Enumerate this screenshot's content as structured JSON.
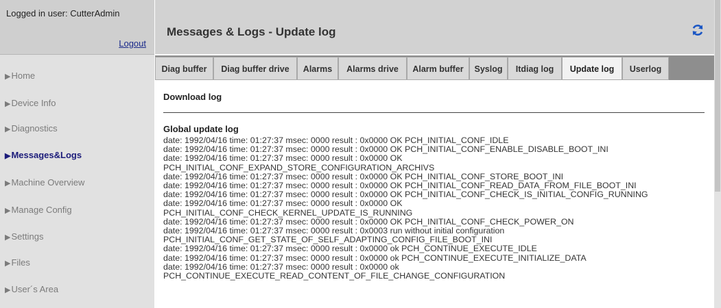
{
  "login": {
    "text": "Logged in user: CutterAdmin",
    "logout": "Logout"
  },
  "nav": {
    "items": [
      {
        "label": "Home",
        "active": false
      },
      {
        "label": "Device Info",
        "active": false
      },
      {
        "label": "Diagnostics",
        "active": false
      },
      {
        "label": "Messages&Logs",
        "active": true
      },
      {
        "label": "Machine Overview",
        "active": false
      },
      {
        "label": "Manage Config",
        "active": false
      },
      {
        "label": "Settings",
        "active": false
      },
      {
        "label": "Files",
        "active": false
      },
      {
        "label": "User´s Area",
        "active": false
      }
    ]
  },
  "header": {
    "title": "Messages & Logs - Update log",
    "refresh_icon": "refresh-icon",
    "refresh_color": "#1a56c4"
  },
  "tabs": [
    {
      "label": "Diag buffer",
      "active": false
    },
    {
      "label": "Diag buffer drive",
      "active": false
    },
    {
      "label": "Alarms",
      "active": false
    },
    {
      "label": "Alarms drive",
      "active": false
    },
    {
      "label": "Alarm buffer",
      "active": false
    },
    {
      "label": "Syslog",
      "active": false
    },
    {
      "label": "Itdiag log",
      "active": false
    },
    {
      "label": "Update log",
      "active": true
    },
    {
      "label": "Userlog",
      "active": false
    }
  ],
  "content": {
    "download_title": "Download log",
    "global_title": "Global update log",
    "log_lines": [
      "date: 1992/04/16 time: 01:27:37 msec: 0000 result : 0x0000 OK PCH_INITIAL_CONF_IDLE",
      "date: 1992/04/16 time: 01:27:37 msec: 0000 result : 0x0000 OK PCH_INITIAL_CONF_ENABLE_DISABLE_BOOT_INI",
      "date: 1992/04/16 time: 01:27:37 msec: 0000 result : 0x0000 OK",
      "PCH_INITIAL_CONF_EXPAND_STORE_CONFIGURATION_ARCHIVS",
      "date: 1992/04/16 time: 01:27:37 msec: 0000 result : 0x0000 OK PCH_INITIAL_CONF_STORE_BOOT_INI",
      "date: 1992/04/16 time: 01:27:37 msec: 0000 result : 0x0000 OK PCH_INITIAL_CONF_READ_DATA_FROM_FILE_BOOT_INI",
      "date: 1992/04/16 time: 01:27:37 msec: 0000 result : 0x0000 OK PCH_INITIAL_CONF_CHECK_IS_INITIAL_CONFIG_RUNNING",
      "date: 1992/04/16 time: 01:27:37 msec: 0000 result : 0x0000 OK",
      "PCH_INITIAL_CONF_CHECK_KERNEL_UPDATE_IS_RUNNING",
      "date: 1992/04/16 time: 01:27:37 msec: 0000 result : 0x0000 OK PCH_INITIAL_CONF_CHECK_POWER_ON",
      "date: 1992/04/16 time: 01:27:37 msec: 0000 result : 0x0003 run without initial configuration",
      "PCH_INITIAL_CONF_GET_STATE_OF_SELF_ADAPTING_CONFIG_FILE_BOOT_INI",
      "date: 1992/04/16 time: 01:27:37 msec: 0000 result : 0x0000 ok PCH_CONTINUE_EXECUTE_IDLE",
      "date: 1992/04/16 time: 01:27:37 msec: 0000 result : 0x0000 ok PCH_CONTINUE_EXECUTE_INITIALIZE_DATA",
      "date: 1992/04/16 time: 01:27:37 msec: 0000 result : 0x0000 ok",
      "PCH_CONTINUE_EXECUTE_READ_CONTENT_OF_FILE_CHANGE_CONFIGURATION"
    ]
  }
}
